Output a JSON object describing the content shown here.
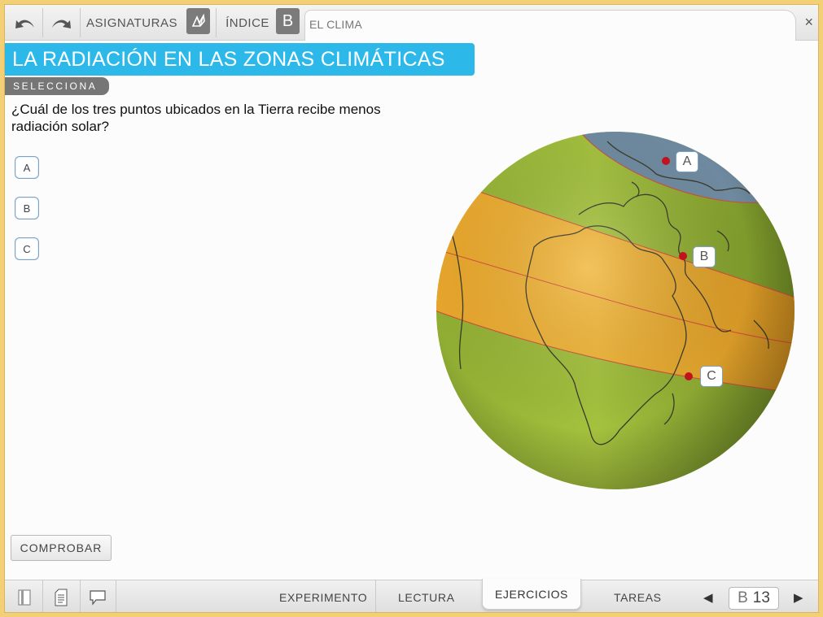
{
  "toolbar": {
    "subjects_label": "ASIGNATURAS",
    "index_label": "ÍNDICE",
    "index_badge": "B",
    "current_tab": "EL CLIMA",
    "close_symbol": "×"
  },
  "title": "LA RADIACIÓN EN LAS ZONAS CLIMÁTICAS",
  "instruction": "SELECCIONA",
  "question": "¿Cuál de los tres puntos ubicados en la Tierra recibe menos radiación solar?",
  "options": [
    "A",
    "B",
    "C"
  ],
  "globe_markers": [
    "A",
    "B",
    "C"
  ],
  "check_label": "COMPROBAR",
  "bottom_tabs": [
    "EXPERIMENTO",
    "LECTURA",
    "EJERCICIOS",
    "TAREAS"
  ],
  "active_tab": "EJERCICIOS",
  "page": {
    "prefix": "B",
    "number": "13"
  },
  "colors": {
    "accent": "#2cb9ea",
    "pill": "#767676",
    "frame": "#f3cf75",
    "marker": "#c1131d",
    "zone_polar": "#6f8aa0",
    "zone_temperate": "#9bb63a",
    "zone_warm": "#e8ad2e"
  },
  "icons": [
    "undo-icon",
    "redo-icon",
    "leaf-icon",
    "bookmark-icon",
    "notes-icon",
    "comment-icon",
    "prev-page-icon",
    "next-page-icon"
  ]
}
